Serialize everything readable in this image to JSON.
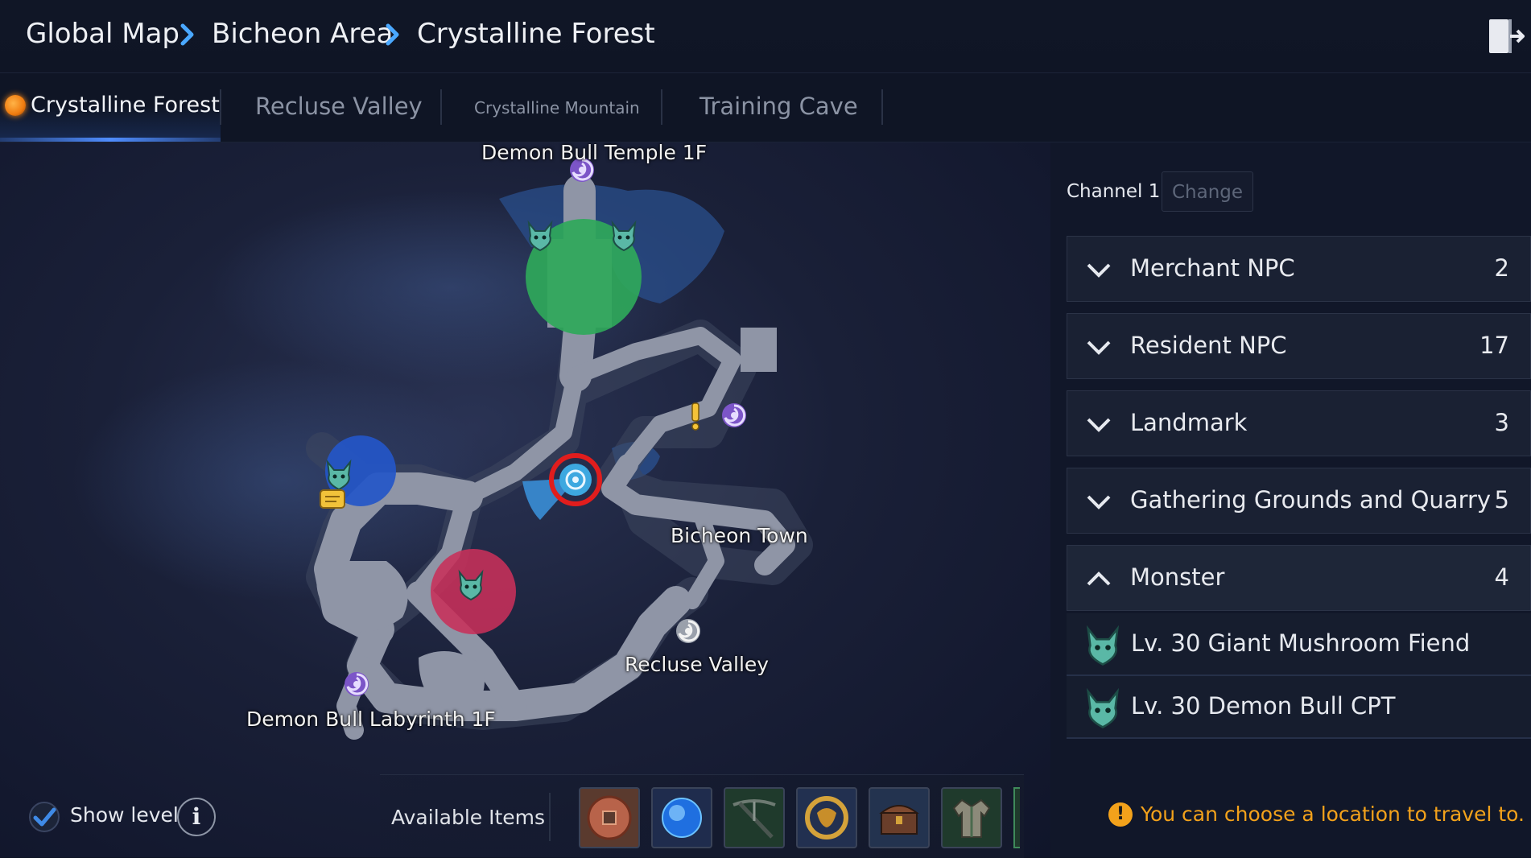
{
  "breadcrumb": {
    "level1": "Global Map",
    "level2": "Bicheon Area",
    "level3": "Crystalline Forest"
  },
  "tabs": [
    {
      "label": "Crystalline Forest",
      "active": true
    },
    {
      "label": "Recluse Valley",
      "active": false
    },
    {
      "label": "Crystalline Mountain",
      "active": false
    },
    {
      "label": "Training Cave",
      "active": false
    }
  ],
  "map": {
    "labels": {
      "demon_bull_temple": "Demon Bull Temple 1F",
      "bicheon_town": "Bicheon Town",
      "recluse_valley": "Recluse Valley",
      "demon_bull_labyrinth": "Demon Bull Labyrinth 1F"
    },
    "colors": {
      "zone_green": "#2fa85a",
      "zone_blue": "#2456c8",
      "zone_pink": "#c8305a",
      "player_marker": "#e11d1d"
    }
  },
  "sidepanel": {
    "channel_label": "Channel 1",
    "change_button": "Change",
    "categories": [
      {
        "label": "Merchant NPC",
        "count": "2",
        "expanded": false
      },
      {
        "label": "Resident NPC",
        "count": "17",
        "expanded": false
      },
      {
        "label": "Landmark",
        "count": "3",
        "expanded": false
      },
      {
        "label": "Gathering Grounds and Quarry",
        "count": "5",
        "expanded": false
      },
      {
        "label": "Monster",
        "count": "4",
        "expanded": true
      }
    ],
    "monsters": [
      {
        "name": "Lv. 30 Giant Mushroom Fiend",
        "icon": "demon-head-icon"
      },
      {
        "name": "Lv. 30 Demon Bull CPT",
        "icon": "demon-head-icon"
      }
    ],
    "hint": "You can choose a location to travel to.",
    "hint_color": "#f3a21b"
  },
  "bottom": {
    "show_level_label": "Show level",
    "show_level_checked": true,
    "available_items_label": "Available Items",
    "items": [
      "coin-icon",
      "blue-orb-icon",
      "crossbow-icon",
      "dragon-medallion-icon",
      "treasure-chest-icon",
      "robe-icon"
    ]
  }
}
